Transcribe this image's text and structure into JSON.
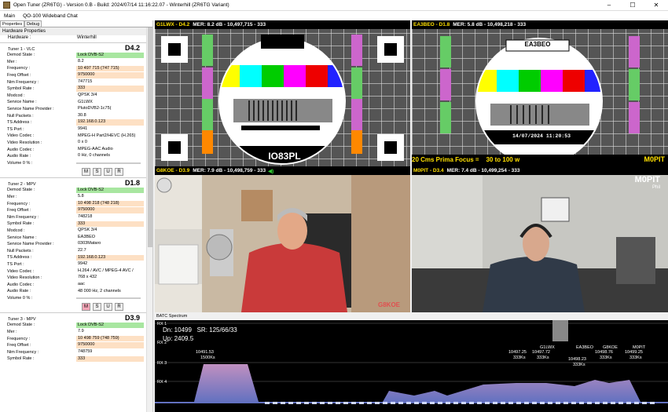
{
  "window": {
    "title": "Open Tuner (ZR6TG) - Version 0.B - Build: 2024/07/14 11:16:22.07 - Winterhill (ZR6TG Variant)",
    "min": "–",
    "max": "☐",
    "close": "✕"
  },
  "menu": [
    "Main",
    "QO-100 Wideband Chat"
  ],
  "left_tabs": [
    "Properties",
    "Debug"
  ],
  "hardware": {
    "group": "Hardware Properties",
    "label": "Hardware :",
    "value": "Winterhill"
  },
  "tuners": [
    {
      "name": "Tuner 1 - VLC",
      "code": "D4.2",
      "rows": [
        [
          "Demod State :",
          "Lock DVB-S2",
          "g"
        ],
        [
          "Mer :",
          "8.2",
          ""
        ],
        [
          "Frequency :",
          "10 497 715 (747 715)",
          "o"
        ],
        [
          "Freq Offset :",
          "9750000",
          "o"
        ],
        [
          "Nim Frequency :",
          "747715",
          ""
        ],
        [
          "Symbol Rate :",
          "333",
          "o"
        ],
        [
          "Modcod :",
          "QPSK 3/4",
          ""
        ],
        [
          "Service Name :",
          "G1LWX",
          ""
        ],
        [
          "Service Name Provider :",
          "PlutoDVB2-1c75(",
          ""
        ],
        [
          "Null Packets :",
          "30.8",
          ""
        ],
        [
          "TS Address :",
          "192.168.0.123",
          "o"
        ],
        [
          "TS Port :",
          "9941",
          ""
        ],
        [
          "Video Codec :",
          "MPEG-H Part2/HEVC (H.265)",
          ""
        ],
        [
          "Video Resolution :",
          "0 x 0",
          ""
        ],
        [
          "Audio Codec :",
          "MPEG-AAC Audio",
          ""
        ],
        [
          "Audio Rate :",
          "0 Hz, 0 channels",
          ""
        ],
        [
          "Volume 0 % :",
          "",
          ""
        ]
      ]
    },
    {
      "name": "Tuner 2 - MPV",
      "code": "D1.8",
      "rows": [
        [
          "Demod State :",
          "Lock DVB-S2",
          "g"
        ],
        [
          "Mer :",
          "5.8",
          ""
        ],
        [
          "Frequency :",
          "10 498 218 (748 218)",
          "o"
        ],
        [
          "Freq Offset :",
          "9750000",
          "o"
        ],
        [
          "Nim Frequency :",
          "748218",
          ""
        ],
        [
          "Symbol Rate :",
          "333",
          "o"
        ],
        [
          "Modcod :",
          "QPSK 3/4",
          ""
        ],
        [
          "Service Name :",
          "EA3BEO",
          ""
        ],
        [
          "Service Name Provider :",
          "0303Mataro",
          ""
        ],
        [
          "Null Packets :",
          "22.7",
          ""
        ],
        [
          "TS Address :",
          "192.168.0.123",
          "o"
        ],
        [
          "TS Port :",
          "9942",
          ""
        ],
        [
          "Video Codec :",
          "H.264 / AVC / MPEG-4 AVC /",
          ""
        ],
        [
          "Video Resolution :",
          "768 x 432",
          ""
        ],
        [
          "Audio Codec :",
          "aac",
          ""
        ],
        [
          "Audio Rate :",
          "48 000 Hz, 2 channels",
          ""
        ],
        [
          "Volume 0 % :",
          "",
          ""
        ]
      ]
    },
    {
      "name": "Tuner 3 - MPV",
      "code": "D3.9",
      "rows": [
        [
          "Demod State :",
          "Lock DVB-S2",
          "g"
        ],
        [
          "Mer :",
          "7.9",
          ""
        ],
        [
          "Frequency :",
          "10 498 759 (748 759)",
          "o"
        ],
        [
          "Freq Offset :",
          "9750000",
          "o"
        ],
        [
          "Nim Frequency :",
          "748759",
          ""
        ],
        [
          "Symbol Rate :",
          "333",
          "o"
        ]
      ]
    }
  ],
  "buttons": [
    "M",
    "S",
    "U",
    "R"
  ],
  "videos": [
    {
      "cs": "G1LWX - D4.2",
      "info": "MER: 8.2 dB - 10,497,715 - 333",
      "label": "G1LWX",
      "loc": "IO83PL"
    },
    {
      "cs": "EA3BEO - D1.8",
      "info": "MER: 5.8 dB - 10,498,218 - 333",
      "label": "EA3BEO",
      "date": "14/07/2024  11:20:53",
      "banner": "20 Cms Prima Focus =    30 to 100 w",
      "tag": "M0PIT"
    },
    {
      "cs": "G8KOE - D3.9",
      "info": "MER: 7.9 dB - 10,498,759 - 333",
      "overlay": "G8KOE"
    },
    {
      "cs": "M0PIT - D3.4",
      "info": "MER: 7.4 dB - 10,499,254 - 333",
      "overlay": "M0PIT",
      "sub": "Phil"
    }
  ],
  "spectrum": {
    "tab": "BATC Spectrum",
    "dn": "Dn: 10499   SR: 125/66/33",
    "up": "Up: 2409.5",
    "rx": [
      "RX 1",
      "RX 2",
      "RX 3",
      "RX 4"
    ],
    "signals": [
      {
        "f": "10491.53",
        "sr": "1500Ks",
        "call": ""
      },
      {
        "f": "10497.25",
        "sr": "333Ks",
        "call": ""
      },
      {
        "f": "10497.72",
        "sr": "333Ks",
        "call": "G1LWX"
      },
      {
        "f": "10498.23",
        "sr": "333Ks",
        "call": "EA3BEO"
      },
      {
        "f": "10498.76",
        "sr": "333Ks",
        "call": "G8KOE"
      },
      {
        "f": "10499.25",
        "sr": "333Ks",
        "call": "M0PIT"
      }
    ]
  }
}
